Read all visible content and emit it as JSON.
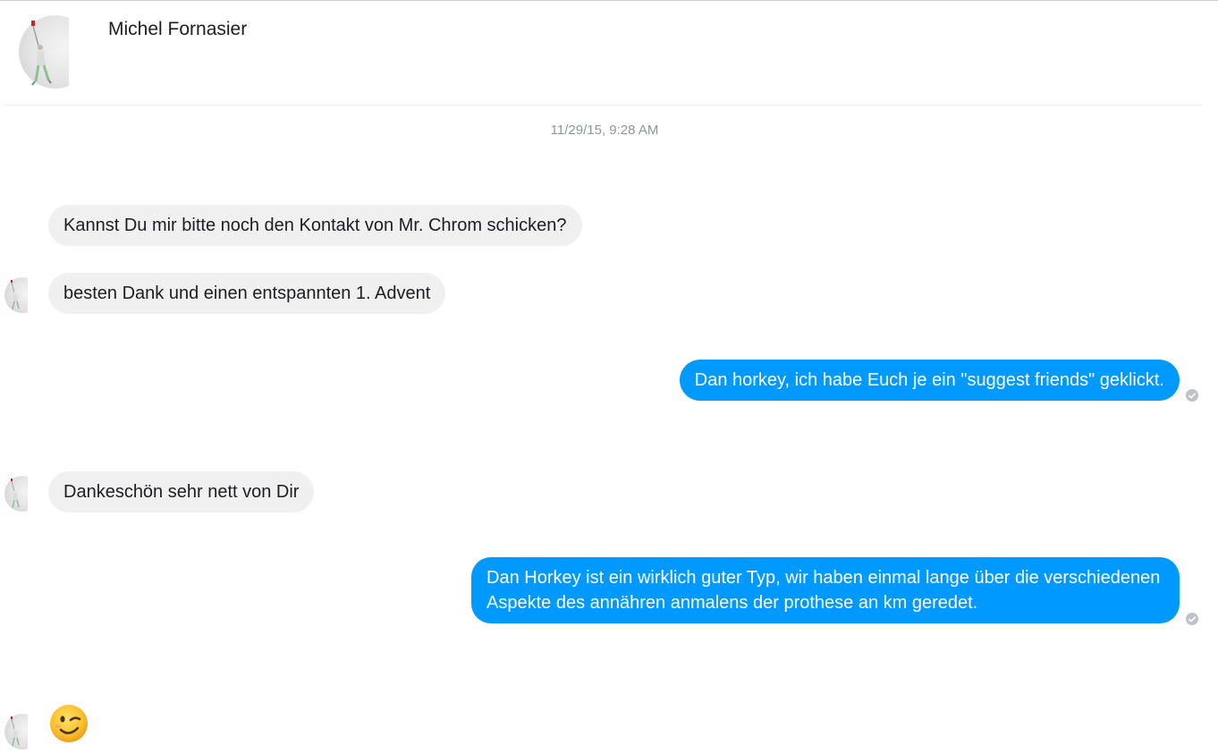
{
  "window": {
    "contact_name": "Michel Fornasier",
    "timestamp": "11/29/15, 9:28 AM"
  },
  "messages": [
    {
      "direction": "incoming",
      "text": "Kannst Du mir bitte noch den Kontakt von Mr. Chrom schicken?",
      "avatar": false
    },
    {
      "direction": "incoming",
      "text": "besten Dank und einen entspannten 1. Advent",
      "avatar": true
    },
    {
      "direction": "outgoing",
      "text": "Dan horkey, ich habe Euch je ein \"suggest friends\" geklickt.",
      "status": "seen"
    },
    {
      "direction": "incoming",
      "text": "Dankeschön sehr nett von Dir",
      "avatar": true
    },
    {
      "direction": "outgoing",
      "text": "Dan Horkey ist ein wirklich guter Typ, wir haben einmal lange über die verschiedenen Aspekte des annähren anmalens der prothese an km geredet.",
      "status": "seen"
    },
    {
      "direction": "incoming",
      "emoji": "winking-face",
      "avatar": true
    }
  ],
  "colors": {
    "incoming_bubble": "#f1f0f0",
    "outgoing_bubble": "#0099ff",
    "timestamp_text": "#90949c",
    "seen_icon": "#bec2c9"
  }
}
